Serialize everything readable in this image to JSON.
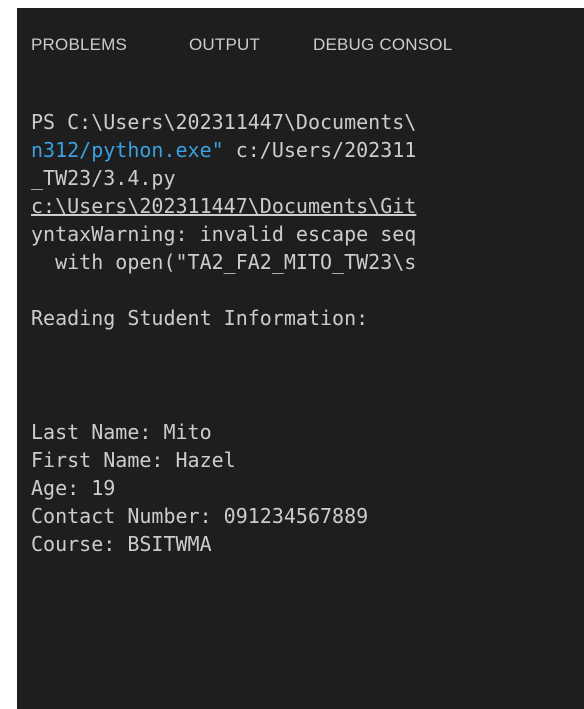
{
  "panel": {
    "tabs": [
      {
        "label": "PROBLEMS"
      },
      {
        "label": "OUTPUT"
      },
      {
        "label": "DEBUG CONSOL"
      }
    ]
  },
  "terminal": {
    "colors": {
      "background": "#1e1e1e",
      "text": "#cccccc",
      "string": "#3aa0e0"
    },
    "lines": [
      {
        "text": "PS C:\\Users\\202311447\\Documents\\"
      },
      {
        "highlight": "n312/python.exe\"",
        "rest": " c:/Users/202311"
      },
      {
        "text": "_TW23/3.4.py"
      },
      {
        "text": "c:\\Users\\202311447\\Documents\\Git"
      },
      {
        "text": "yntaxWarning: invalid escape seq"
      },
      {
        "text": "  with open(\"TA2_FA2_MITO_TW23\\s"
      },
      {
        "text": "Reading Student Information:"
      },
      {
        "text": "Last Name: Mito"
      },
      {
        "text": "First Name: Hazel"
      },
      {
        "text": "Age: 19"
      },
      {
        "text": "Contact Number: 091234567889"
      },
      {
        "text": "Course: BSITWMA"
      }
    ]
  }
}
